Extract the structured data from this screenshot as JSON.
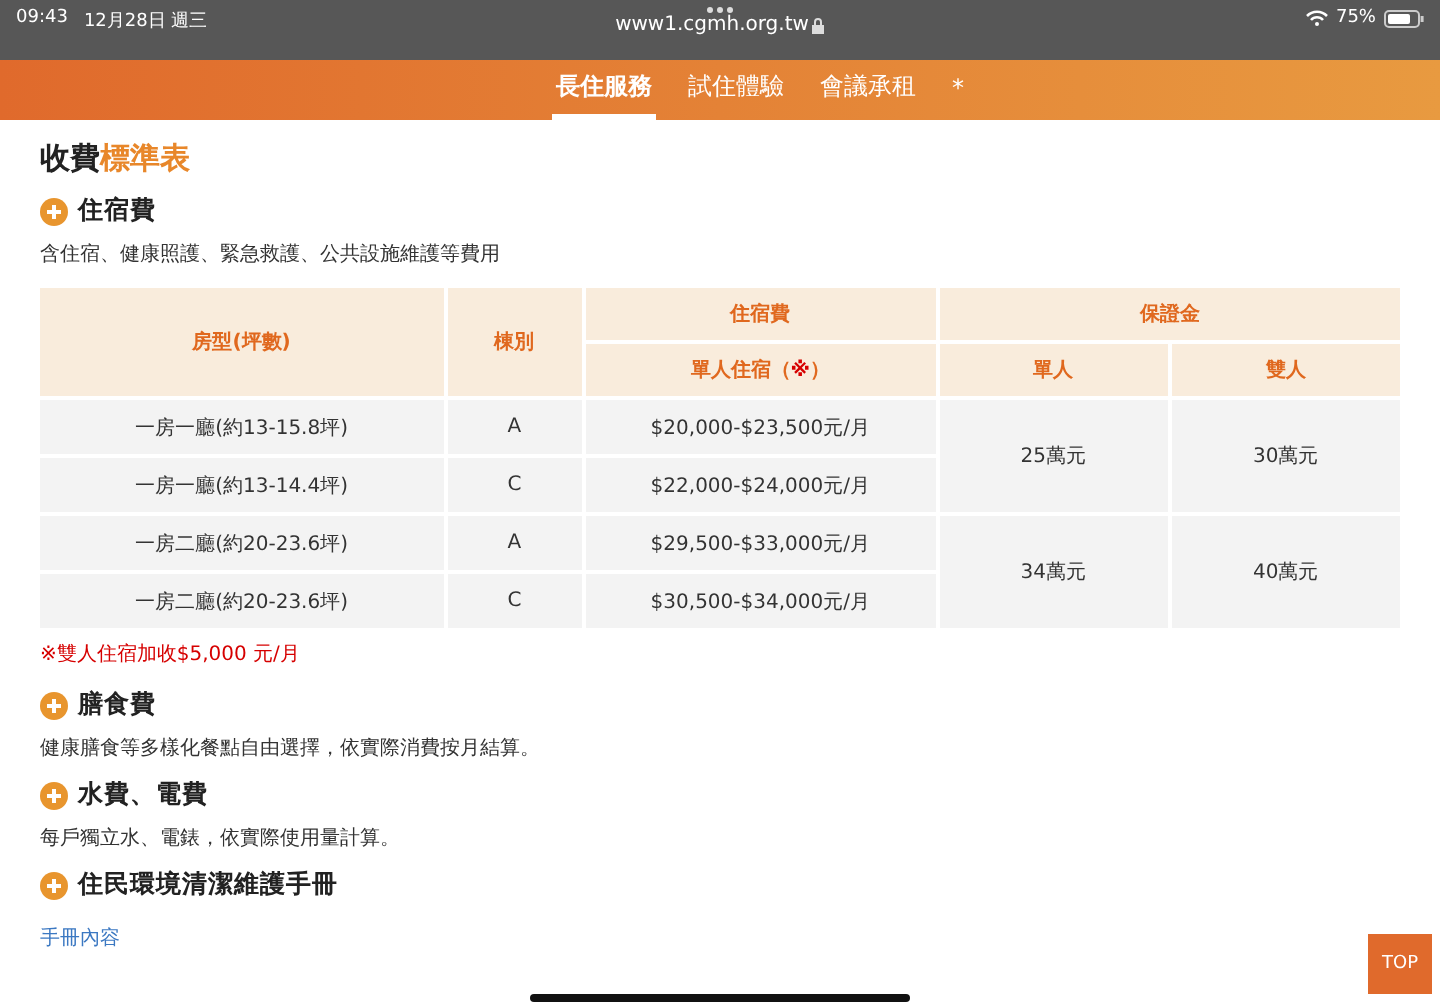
{
  "status_bar": {
    "time": "09:43",
    "date": "12月28日 週三",
    "url": "www1.cgmh.org.tw",
    "battery": "75%"
  },
  "nav": {
    "tabs": [
      {
        "label": "長住服務",
        "selected": true
      },
      {
        "label": "試住體驗",
        "selected": false
      },
      {
        "label": "會議承租",
        "selected": false
      },
      {
        "label": "*",
        "selected": false
      }
    ]
  },
  "page_title": {
    "text": "收費",
    "highlight": "標準表"
  },
  "sections": [
    {
      "title": "住宿費",
      "text": "含住宿、健康照護、緊急救護、公共設施維護等費用",
      "table": {
        "headers": {
          "room": "房型(坪數)",
          "building": "棟別",
          "fee": "住宿費",
          "fee_sub": "單人住宿（",
          "fee_mark": "※",
          "fee_sub_end": "）",
          "deposit": "保證金",
          "single": "單人",
          "double": "雙人"
        },
        "groups": [
          {
            "single": "25萬元",
            "double": "30萬元",
            "rows": [
              {
                "room": "一房一廳(約13-15.8坪)",
                "building": "A",
                "price": "$20,000-$23,500元/月"
              },
              {
                "room": "一房一廳(約13-14.4坪)",
                "building": "C",
                "price": "$22,000-$24,000元/月"
              }
            ]
          },
          {
            "single": "34萬元",
            "double": "40萬元",
            "rows": [
              {
                "room": "一房二廳(約20-23.6坪)",
                "building": "A",
                "price": "$29,500-$33,000元/月"
              },
              {
                "room": "一房二廳(約20-23.6坪)",
                "building": "C",
                "price": "$30,500-$34,000元/月"
              }
            ]
          }
        ]
      },
      "note": "※雙人住宿加收$5,000 元/月"
    },
    {
      "title": "膳食費",
      "text": "健康膳食等多樣化餐點自由選擇，依實際消費按月結算。"
    },
    {
      "title": "水費、電費",
      "text": "每戶獨立水、電錶，依實際使用量計算。"
    },
    {
      "title": "住民環境清潔維護手冊",
      "link": "手冊內容"
    }
  ],
  "top_button": "TOP"
}
